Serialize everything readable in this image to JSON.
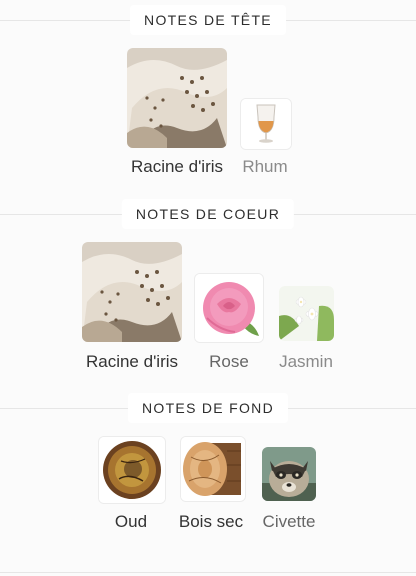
{
  "sections": [
    {
      "title": "NOTES DE TÊTE",
      "notes": [
        {
          "label": "Racine d'iris",
          "icon": "iris-root-image"
        },
        {
          "label": "Rhum",
          "icon": "rum-glass-image"
        }
      ]
    },
    {
      "title": "NOTES DE COEUR",
      "notes": [
        {
          "label": "Racine d'iris",
          "icon": "iris-root-image"
        },
        {
          "label": "Rose",
          "icon": "rose-image"
        },
        {
          "label": "Jasmin",
          "icon": "jasmine-image"
        }
      ]
    },
    {
      "title": "NOTES DE FOND",
      "notes": [
        {
          "label": "Oud",
          "icon": "oud-wood-image"
        },
        {
          "label": "Bois sec",
          "icon": "dry-wood-image"
        },
        {
          "label": "Civette",
          "icon": "civet-image"
        }
      ]
    }
  ],
  "colors": {
    "background": "#fbfbfb",
    "header_pill": "#ffffff",
    "divider": "#e6e6e6",
    "text_primary": "#333333"
  }
}
